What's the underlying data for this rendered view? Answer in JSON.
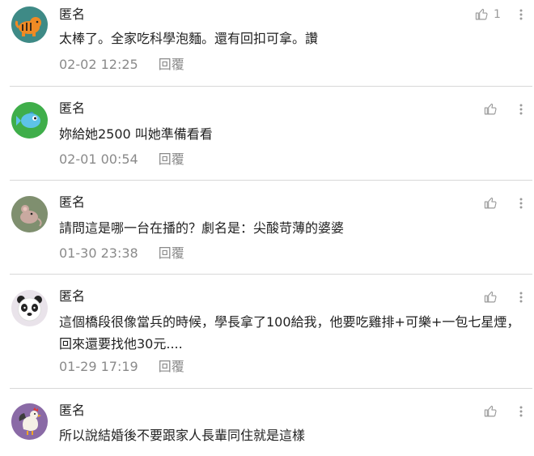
{
  "comments": [
    {
      "author": "匿名",
      "text": "太棒了。全家吃科學泡麵。還有回扣可拿。讚",
      "time": "02-02 12:25",
      "reply": "回覆",
      "likes": "1",
      "avatar_icon": "tiger-icon",
      "avatar_bg": "#3e8a86"
    },
    {
      "author": "匿名",
      "text": "妳給她2500 叫她準備看看",
      "time": "02-01 00:54",
      "reply": "回覆",
      "likes": "",
      "avatar_icon": "fish-icon",
      "avatar_bg": "#3fae4a"
    },
    {
      "author": "匿名",
      "text": "請問這是哪一台在播的？劇名是：尖酸苛薄的婆婆",
      "time": "01-30 23:38",
      "reply": "回覆",
      "likes": "",
      "avatar_icon": "rat-icon",
      "avatar_bg": "#7f8f6f"
    },
    {
      "author": "匿名",
      "text": "這個橋段很像當兵的時候，學長拿了100給我，他要吃雞排+可樂+一包七星煙，回來還要找他30元....",
      "time": "01-29 17:19",
      "reply": "回覆",
      "likes": "",
      "avatar_icon": "panda-icon",
      "avatar_bg": "#e9e3ea"
    },
    {
      "author": "匿名",
      "text": "所以說結婚後不要跟家人長輩同住就是這樣",
      "time": "",
      "reply": "",
      "likes": "",
      "avatar_icon": "rooster-icon",
      "avatar_bg": "#8a6aa6"
    }
  ],
  "colors": {
    "meta": "#8a8a8a",
    "divider": "#d8d8d8",
    "icon": "#9a9a9a"
  }
}
